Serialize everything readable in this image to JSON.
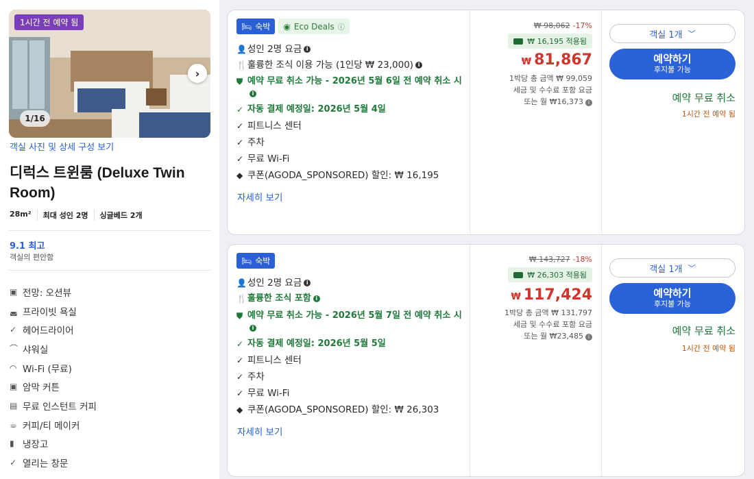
{
  "left": {
    "badge": "1시간 전 예약 됨",
    "counter": "1/16",
    "next_icon": "chevron-right-icon",
    "photo_link": "객실 사진 및 상세 구성 보기",
    "title": "디럭스 트윈룸 (Deluxe Twin Room)",
    "specs": [
      "28m²",
      "최대 성인 2명",
      "싱글베드 2개"
    ],
    "score": "9.1 최고",
    "score_sub": "객실의 편안함",
    "amenities": [
      {
        "icon": "view-icon",
        "label": "전망: 오션뷰"
      },
      {
        "icon": "bath-icon",
        "label": "프라이빗 욕실"
      },
      {
        "icon": "check-icon",
        "label": "헤어드라이어"
      },
      {
        "icon": "shower-icon",
        "label": "샤워실"
      },
      {
        "icon": "wifi-icon",
        "label": "Wi-Fi (무료)"
      },
      {
        "icon": "curtain-icon",
        "label": "암막 커튼"
      },
      {
        "icon": "coffee-machine-icon",
        "label": "무료 인스턴트 커피"
      },
      {
        "icon": "kettle-icon",
        "label": "커피/티 메이커"
      },
      {
        "icon": "fridge-icon",
        "label": "냉장고"
      },
      {
        "icon": "check-icon",
        "label": "열리는 창문"
      }
    ]
  },
  "offers": [
    {
      "tag": "숙박",
      "eco": "Eco Deals",
      "guests": "성인 2명 요금",
      "breakfast": "훌륭한 조식 이용 가능 (1인당 ₩ 23,000)",
      "cancel": "예약 무료 취소 가능 - 2026년 5월 6일 전 예약 취소 시",
      "payment": "자동 결제 예정일: 2026년 5월 4일",
      "fitness": "피트니스 센터",
      "parking": "주차",
      "wifi": "무료 Wi-Fi",
      "coupon": "쿠폰(AGODA_SPONSORED) 할인: ₩ 16,195",
      "detail": "자세히 보기",
      "orig_price": "₩ 98,062",
      "discount": "-17%",
      "coupon_applied": "₩ 16,195 적용됨",
      "currency": "₩",
      "price": "81,867",
      "total": "1박당 총 금액 ₩ 99,059",
      "tax_note": "세금 및 수수료 포함 요금",
      "monthly": "또는 월 ₩16,373",
      "room_count": "객실 1개",
      "book": "예약하기",
      "book_sub": "후지불 가능",
      "free_cancel": "예약 무료 취소",
      "booked_ago": "1시간 전 예약 됨"
    },
    {
      "tag": "숙박",
      "guests": "성인 2명 요금",
      "breakfast": "훌륭한 조식 포함",
      "cancel": "예약 무료 취소 가능 - 2026년 5월 7일 전 예약 취소 시",
      "payment": "자동 결제 예정일: 2026년 5월 5일",
      "fitness": "피트니스 센터",
      "parking": "주차",
      "wifi": "무료 Wi-Fi",
      "coupon": "쿠폰(AGODA_SPONSORED) 할인: ₩ 26,303",
      "detail": "자세히 보기",
      "orig_price": "₩ 143,727",
      "discount": "-18%",
      "coupon_applied": "₩ 26,303 적용됨",
      "currency": "₩",
      "price": "117,424",
      "total": "1박당 총 금액 ₩ 131,797",
      "tax_note": "세금 및 수수료 포함 요금",
      "monthly": "또는 월 ₩23,485",
      "room_count": "객실 1개",
      "book": "예약하기",
      "book_sub": "후지불 가능",
      "free_cancel": "예약 무료 취소",
      "booked_ago": "1시간 전 예약 됨"
    }
  ],
  "colors": {
    "accent": "#2a5fd6",
    "price": "#d0352b",
    "green": "#1f7a3a",
    "badge": "#7a3fb8"
  }
}
